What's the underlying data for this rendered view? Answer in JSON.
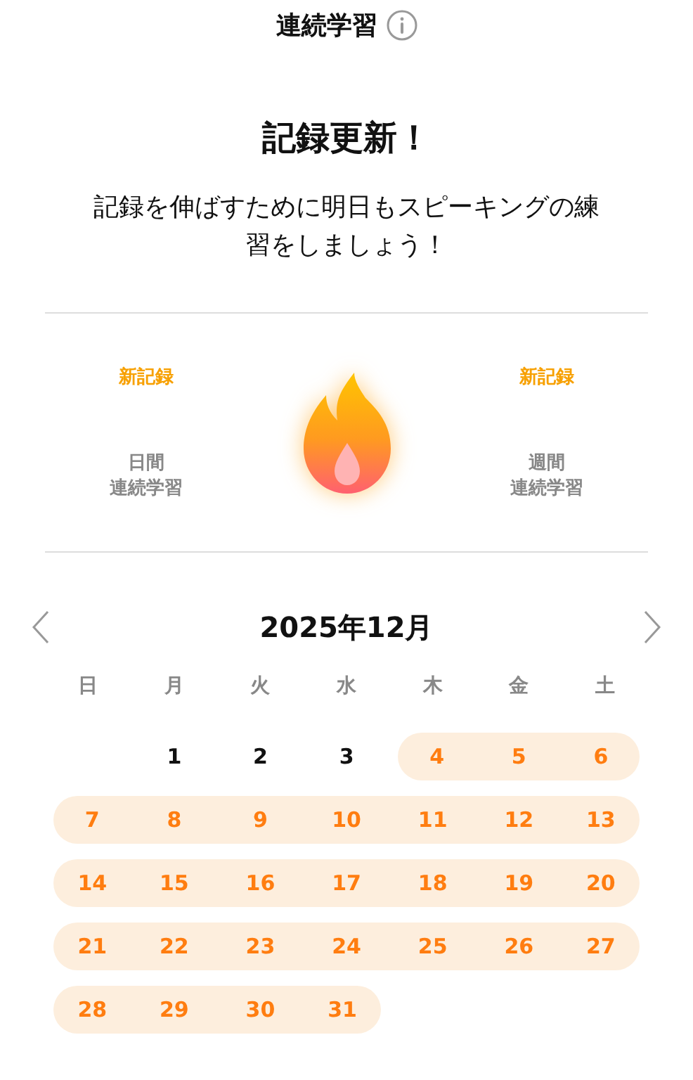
{
  "header": {
    "title": "連続学習"
  },
  "headline": "記録更新！",
  "message": "記録を伸ばすために明日もスピーキングの練習をしましょう！",
  "stats": [
    {
      "badge": "新記録",
      "label_lines": [
        "日間",
        "連続学習"
      ]
    },
    {
      "badge": "新記録",
      "label_lines": [
        "週間",
        "連続学習"
      ]
    }
  ],
  "calendar": {
    "month": "2025年12月",
    "weekdays": [
      "日",
      "月",
      "火",
      "水",
      "木",
      "金",
      "土"
    ],
    "weeks": [
      [
        {
          "day": "1",
          "studied": false
        },
        {
          "day": "2",
          "studied": false
        },
        {
          "day": "3",
          "studied": false
        },
        {
          "day": "4",
          "studied": true
        },
        {
          "day": "5",
          "studied": true
        },
        {
          "day": "6",
          "studied": true
        }
      ],
      [
        {
          "day": "7",
          "studied": true
        },
        {
          "day": "8",
          "studied": true
        },
        {
          "day": "9",
          "studied": true
        },
        {
          "day": "10",
          "studied": true
        },
        {
          "day": "11",
          "studied": true
        },
        {
          "day": "12",
          "studied": true
        },
        {
          "day": "13",
          "studied": true
        }
      ],
      [
        {
          "day": "14",
          "studied": true
        },
        {
          "day": "15",
          "studied": true
        },
        {
          "day": "16",
          "studied": true
        },
        {
          "day": "17",
          "studied": true
        },
        {
          "day": "18",
          "studied": true
        },
        {
          "day": "19",
          "studied": true
        },
        {
          "day": "20",
          "studied": true
        }
      ],
      [
        {
          "day": "21",
          "studied": true
        },
        {
          "day": "22",
          "studied": true
        },
        {
          "day": "23",
          "studied": true
        },
        {
          "day": "24",
          "studied": true
        },
        {
          "day": "25",
          "studied": true
        },
        {
          "day": "26",
          "studied": true
        },
        {
          "day": "27",
          "studied": true
        }
      ],
      [
        {
          "day": "28",
          "studied": true
        },
        {
          "day": "29",
          "studied": true
        },
        {
          "day": "30",
          "studied": true
        },
        {
          "day": "31",
          "studied": true
        }
      ]
    ]
  }
}
